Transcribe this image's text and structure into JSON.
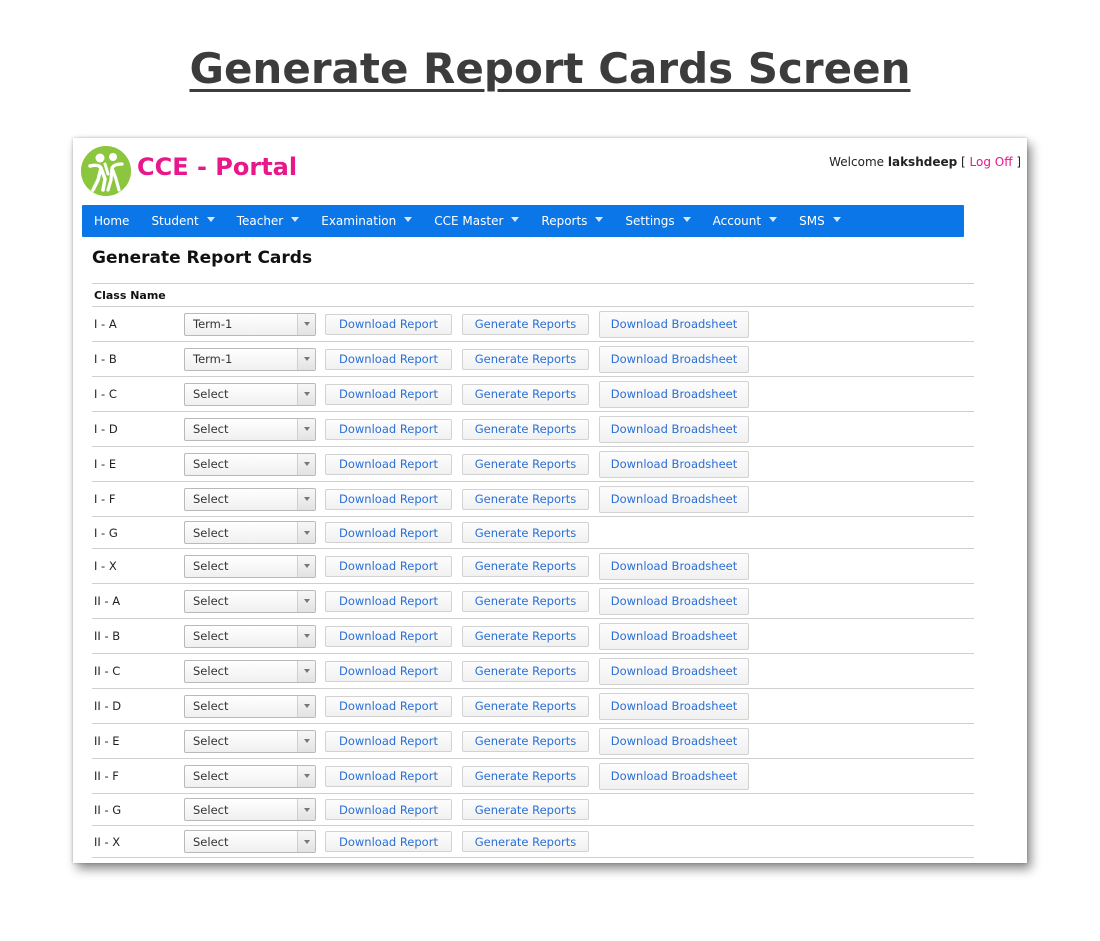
{
  "doc_title": "Generate Report Cards Screen",
  "header": {
    "brand": "CCE - Portal",
    "welcome_prefix": "Welcome ",
    "username": "lakshdeep",
    "logoff_open": "[ ",
    "logoff_label": "Log Off",
    "logoff_close": " ]"
  },
  "nav": [
    {
      "label": "Home",
      "dropdown": false
    },
    {
      "label": "Student",
      "dropdown": true
    },
    {
      "label": "Teacher",
      "dropdown": true
    },
    {
      "label": "Examination",
      "dropdown": true
    },
    {
      "label": "CCE Master",
      "dropdown": true
    },
    {
      "label": "Reports",
      "dropdown": true
    },
    {
      "label": "Settings",
      "dropdown": true
    },
    {
      "label": "Account",
      "dropdown": true
    },
    {
      "label": "SMS",
      "dropdown": true
    }
  ],
  "page_heading": "Generate Report Cards",
  "table": {
    "column_header": "Class Name",
    "download_label": "Download Report",
    "generate_label": "Generate Reports",
    "broadsheet_label": "Download Broadsheet",
    "rows": [
      {
        "class": "I - A",
        "term": "Term-1",
        "broadsheet": true
      },
      {
        "class": "I - B",
        "term": "Term-1",
        "broadsheet": true
      },
      {
        "class": "I - C",
        "term": "Select",
        "broadsheet": true
      },
      {
        "class": "I - D",
        "term": "Select",
        "broadsheet": true
      },
      {
        "class": "I - E",
        "term": "Select",
        "broadsheet": true
      },
      {
        "class": "I - F",
        "term": "Select",
        "broadsheet": true
      },
      {
        "class": "I - G",
        "term": "Select",
        "broadsheet": false
      },
      {
        "class": "I - X",
        "term": "Select",
        "broadsheet": true
      },
      {
        "class": "II - A",
        "term": "Select",
        "broadsheet": true
      },
      {
        "class": "II - B",
        "term": "Select",
        "broadsheet": true
      },
      {
        "class": "II - C",
        "term": "Select",
        "broadsheet": true
      },
      {
        "class": "II - D",
        "term": "Select",
        "broadsheet": true
      },
      {
        "class": "II - E",
        "term": "Select",
        "broadsheet": true
      },
      {
        "class": "II - F",
        "term": "Select",
        "broadsheet": true
      },
      {
        "class": "II - G",
        "term": "Select",
        "broadsheet": false
      },
      {
        "class": "II - X",
        "term": "Select",
        "broadsheet": false
      }
    ]
  },
  "colors": {
    "brand": "#e8178a",
    "nav_bg": "#0a76e8",
    "link": "#2a6fd6",
    "logo_green": "#8cc63f"
  }
}
